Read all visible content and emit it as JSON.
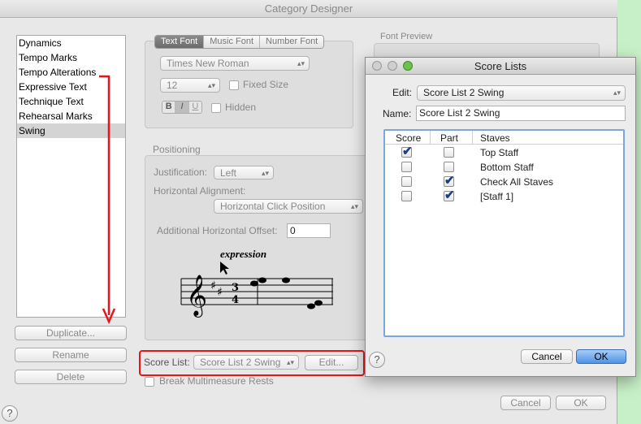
{
  "window": {
    "title": "Category Designer"
  },
  "categories": {
    "items": [
      {
        "label": "Dynamics"
      },
      {
        "label": "Tempo Marks"
      },
      {
        "label": "Tempo Alterations"
      },
      {
        "label": "Expressive Text"
      },
      {
        "label": "Technique Text"
      },
      {
        "label": "Rehearsal Marks"
      },
      {
        "label": "Swing",
        "selected": true
      }
    ]
  },
  "left_buttons": {
    "duplicate": "Duplicate...",
    "rename": "Rename",
    "delete": "Delete"
  },
  "font_tabs": {
    "items": [
      "Text Font",
      "Music Font",
      "Number Font"
    ],
    "active": "Text Font"
  },
  "font": {
    "family": "Times New Roman",
    "size": "12",
    "fixed_size": "Fixed Size",
    "bold": "B",
    "italic": "I",
    "underline": "U",
    "hidden": "Hidden"
  },
  "font_preview_label": "Font Preview",
  "positioning": {
    "label": "Positioning",
    "justification_label": "Justification:",
    "justification_value": "Left",
    "horizontal_alignment_label": "Horizontal Alignment:",
    "horizontal_alignment_value": "Horizontal Click Position",
    "offset_label": "Additional Horizontal Offset:",
    "offset_value": "0",
    "preview_text": "expression"
  },
  "score_list": {
    "label": "Score List:",
    "value": "Score List 2 Swing",
    "edit_button": "Edit..."
  },
  "break_rests": "Break Multimeasure Rests",
  "main_buttons": {
    "cancel": "Cancel",
    "ok": "OK",
    "help": "?"
  },
  "score_lists_dialog": {
    "title": "Score Lists",
    "edit_label": "Edit:",
    "edit_value": "Score List 2 Swing",
    "name_label": "Name:",
    "name_value": "Score List 2 Swing",
    "columns": [
      "Score",
      "Part",
      "Staves"
    ],
    "rows": [
      {
        "score": true,
        "part": false,
        "staff": "Top Staff"
      },
      {
        "score": false,
        "part": false,
        "staff": "Bottom Staff"
      },
      {
        "score": false,
        "part": true,
        "staff": "Check All Staves"
      },
      {
        "score": false,
        "part": true,
        "staff": "[Staff 1]"
      }
    ],
    "cancel": "Cancel",
    "ok": "OK",
    "help": "?"
  },
  "colors": {
    "accent_red": "#e8141c",
    "default_button_blue": "#4e94e6",
    "table_focus": "#7aa7e0"
  }
}
